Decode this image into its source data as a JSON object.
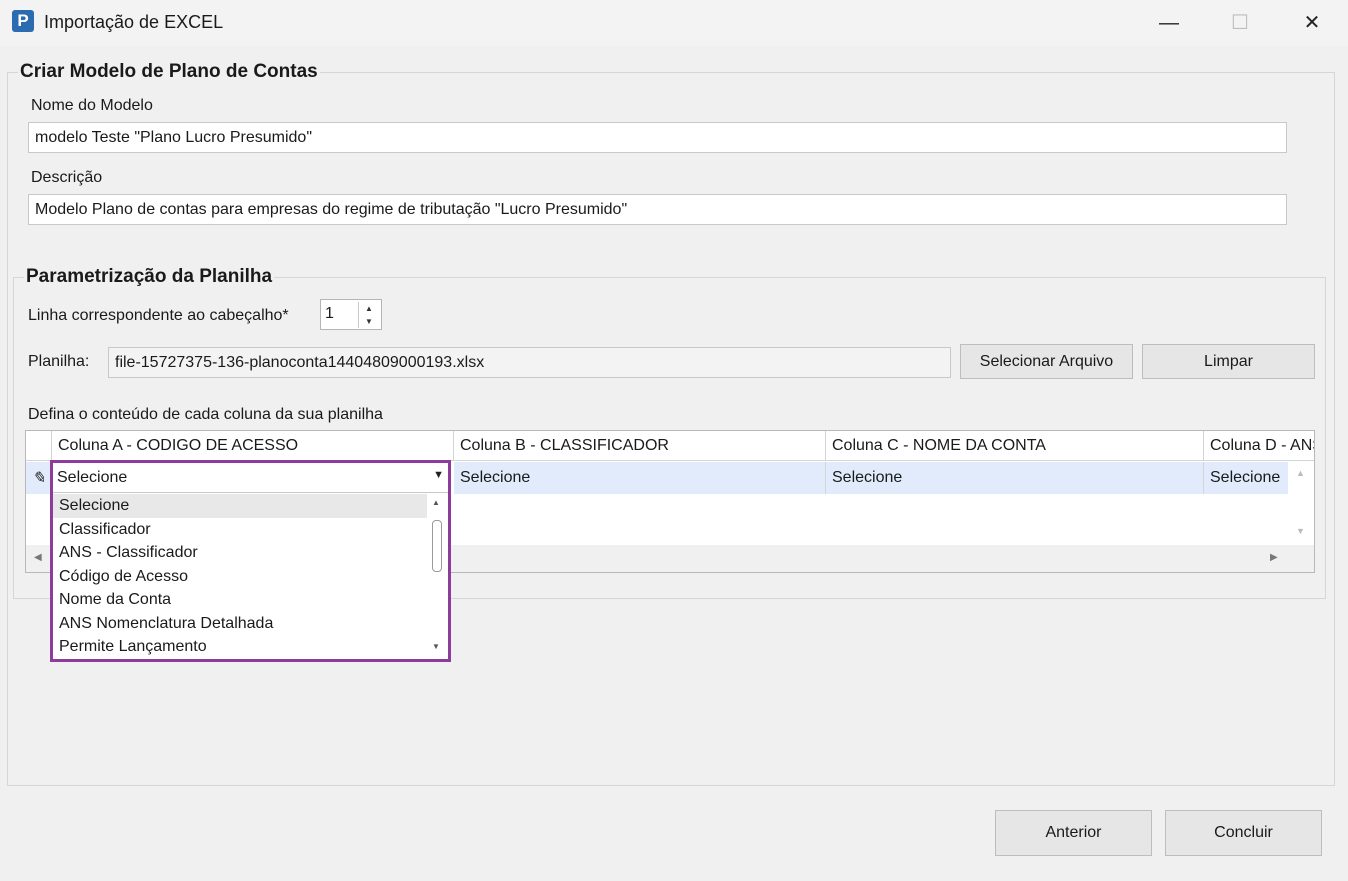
{
  "window": {
    "title": "Importação de EXCEL",
    "app_icon_letter": "P",
    "minimize": "—",
    "maximize": "☐",
    "close": "✕"
  },
  "model_group": {
    "title": "Criar Modelo de Plano de Contas",
    "name_label": "Nome do Modelo",
    "name_value": "modelo Teste \"Plano Lucro Presumido\"",
    "description_label": "Descrição",
    "description_value": "Modelo Plano de contas para empresas do regime de tributação \"Lucro Presumido\""
  },
  "params_group": {
    "title": "Parametrização da Planilha",
    "header_line_label": "Linha correspondente ao cabeçalho*",
    "header_line_value": "1",
    "sheet_label": "Planilha:",
    "sheet_value": "file-15727375-136-planoconta14404809000193.xlsx",
    "select_file_button": "Selecionar Arquivo",
    "clear_button": "Limpar",
    "columns_label": "Defina o conteúdo de cada coluna da sua planilha"
  },
  "grid": {
    "columns": [
      "Coluna A - CODIGO DE ACESSO",
      "Coluna B - CLASSIFICADOR",
      "Coluna C - NOME DA CONTA",
      "Coluna D - ANS NOMENCLATURA"
    ],
    "row_values": [
      "Selecione",
      "Selecione",
      "Selecione",
      "Selecione"
    ],
    "row_indicator_icon": "pencil-icon"
  },
  "dropdown": {
    "options": [
      "Selecione",
      "Classificador",
      "ANS - Classificador",
      "Código de Acesso",
      "Nome da Conta",
      "ANS Nomenclatura Detalhada",
      "Permite Lançamento"
    ],
    "selected_index": 0,
    "highlight_color": "#8e3c9c"
  },
  "footer": {
    "previous_button": "Anterior",
    "finish_button": "Concluir"
  }
}
